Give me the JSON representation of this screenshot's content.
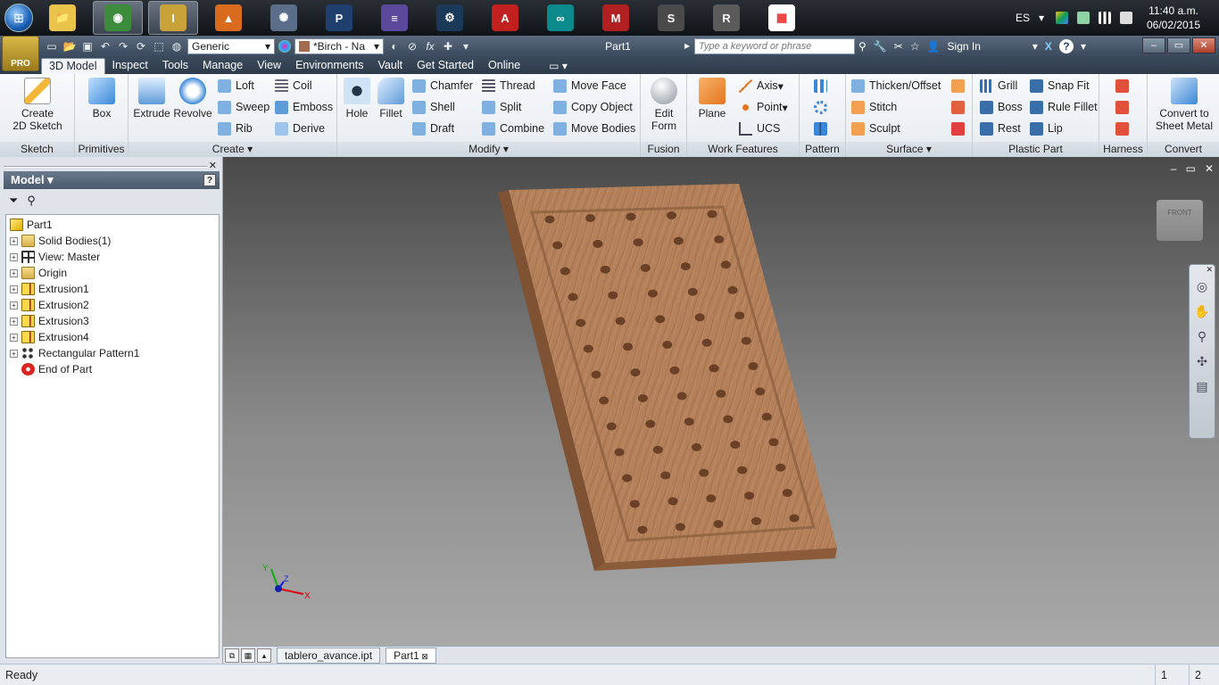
{
  "taskbar": {
    "apps": [
      {
        "name": "windows-explorer",
        "color": "#e9c34a",
        "glyph": "📁"
      },
      {
        "name": "chrome",
        "color": "#3d8b3d",
        "glyph": "◉"
      },
      {
        "name": "inventor",
        "color": "#c9a23a",
        "glyph": "I"
      },
      {
        "name": "matlab",
        "color": "#d96b1f",
        "glyph": "▲"
      },
      {
        "name": "atom-app",
        "color": "#5a6e8a",
        "glyph": "✺"
      },
      {
        "name": "processing",
        "color": "#1f3f6f",
        "glyph": "P"
      },
      {
        "name": "mixer-app",
        "color": "#5b4a9b",
        "glyph": "≡"
      },
      {
        "name": "steam",
        "color": "#1b3a5a",
        "glyph": "⚙"
      },
      {
        "name": "acrobat",
        "color": "#c0201e",
        "glyph": "A"
      },
      {
        "name": "arduino",
        "color": "#0a8a8a",
        "glyph": "∞"
      },
      {
        "name": "mplab",
        "color": "#b02020",
        "glyph": "M"
      },
      {
        "name": "sublime",
        "color": "#4a4a4a",
        "glyph": "S"
      },
      {
        "name": "rhino",
        "color": "#5a5a5a",
        "glyph": "R"
      },
      {
        "name": "tiles-app",
        "color": "#ffffff",
        "glyph": "▦"
      }
    ],
    "language": "ES",
    "time": "11:40 a.m.",
    "date": "06/02/2015"
  },
  "titlebar": {
    "app_badge": "PRO",
    "material_combo": "Generic",
    "appearance_combo": "*Birch - Na",
    "document_title": "Part1",
    "search_placeholder": "Type a keyword or phrase",
    "sign_in": "Sign In"
  },
  "tabs": [
    "3D Model",
    "Inspect",
    "Tools",
    "Manage",
    "View",
    "Environments",
    "Vault",
    "Get Started",
    "Online"
  ],
  "ribbon": {
    "sketch": {
      "title": "Sketch",
      "create_2d_sketch": "Create\n2D Sketch"
    },
    "primitives": {
      "title": "Primitives",
      "box": "Box"
    },
    "create": {
      "title": "Create",
      "extrude": "Extrude",
      "revolve": "Revolve",
      "loft": "Loft",
      "sweep": "Sweep",
      "rib": "Rib",
      "coil": "Coil",
      "emboss": "Emboss",
      "derive": "Derive"
    },
    "modify": {
      "title": "Modify",
      "hole": "Hole",
      "fillet": "Fillet",
      "chamfer": "Chamfer",
      "shell": "Shell",
      "draft": "Draft",
      "thread": "Thread",
      "split": "Split",
      "combine": "Combine",
      "move_face": "Move Face",
      "copy_object": "Copy Object",
      "move_bodies": "Move Bodies"
    },
    "fusion": {
      "title": "Fusion",
      "edit_form": "Edit\nForm"
    },
    "work_features": {
      "title": "Work Features",
      "plane": "Plane",
      "axis": "Axis",
      "point": "Point",
      "ucs": "UCS"
    },
    "pattern": {
      "title": "Pattern"
    },
    "surface": {
      "title": "Surface",
      "thicken_offset": "Thicken/Offset",
      "stitch": "Stitch",
      "sculpt": "Sculpt"
    },
    "plastic_part": {
      "title": "Plastic Part",
      "grill": "Grill",
      "boss": "Boss",
      "rest": "Rest",
      "snap_fit": "Snap Fit",
      "rule_fillet": "Rule Fillet",
      "lip": "Lip"
    },
    "harness": {
      "title": "Harness"
    },
    "convert": {
      "title": "Convert",
      "convert_to_sheet_metal": "Convert to\nSheet Metal"
    }
  },
  "browser": {
    "title": "Model",
    "tree": [
      {
        "label": "Part1",
        "icon": "part-icon",
        "expandable": false,
        "level": 0
      },
      {
        "label": "Solid Bodies(1)",
        "icon": "folder-icon",
        "expandable": true,
        "level": 1
      },
      {
        "label": "View: Master",
        "icon": "view-icon",
        "expandable": true,
        "level": 1
      },
      {
        "label": "Origin",
        "icon": "folder-icon",
        "expandable": true,
        "level": 1
      },
      {
        "label": "Extrusion1",
        "icon": "extrusion-icon",
        "expandable": true,
        "level": 1
      },
      {
        "label": "Extrusion2",
        "icon": "extrusion-icon",
        "expandable": true,
        "level": 1
      },
      {
        "label": "Extrusion3",
        "icon": "extrusion-icon",
        "expandable": true,
        "level": 1
      },
      {
        "label": "Extrusion4",
        "icon": "extrusion-icon",
        "expandable": true,
        "level": 1
      },
      {
        "label": "Rectangular Pattern1",
        "icon": "pattern-icon",
        "expandable": true,
        "level": 1
      },
      {
        "label": "End of Part",
        "icon": "end-of-part-icon",
        "expandable": false,
        "level": 1
      }
    ]
  },
  "viewport": {
    "viewcube_label": "FRONT",
    "axis_labels": {
      "x": "X",
      "y": "Y",
      "z": "Z"
    },
    "hole_grid": {
      "rows": 13,
      "cols": 5
    }
  },
  "doc_tabs": [
    "tablero_avance.ipt",
    "Part1"
  ],
  "status": {
    "text": "Ready",
    "n1": "1",
    "n2": "2"
  },
  "colors": {
    "wood": "#b07b52",
    "wood_dark": "#8a5a36",
    "accent": "#2a66c8"
  }
}
